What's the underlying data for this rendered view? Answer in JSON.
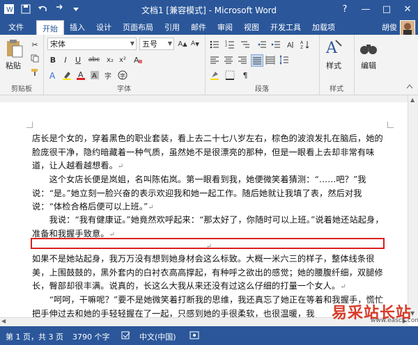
{
  "window": {
    "title": "文档1 [兼容模式] - Microsoft Word",
    "controls": [
      "?",
      "—",
      "□",
      "✕"
    ]
  },
  "tabs": {
    "file": "文件",
    "items": [
      "开始",
      "插入",
      "设计",
      "页面布局",
      "引用",
      "邮件",
      "审阅",
      "视图",
      "开发工具",
      "加载项"
    ],
    "active": "开始",
    "user": "胡俊"
  },
  "ribbon": {
    "clipboard": {
      "paste": "粘贴",
      "label": "剪贴板"
    },
    "font": {
      "name": "宋体",
      "size": "五号",
      "label": "字体",
      "buttons": [
        "B",
        "I",
        "U",
        "abc",
        "x₂",
        "x²"
      ]
    },
    "paragraph": {
      "label": "段落"
    },
    "styles": {
      "button": "样式",
      "label": "样式"
    },
    "editing": {
      "button": "编辑"
    }
  },
  "document": {
    "paragraphs": [
      "店长是个女的，穿着黑色的职业套装，看上去二十七八岁左右，棕色的波浪发扎在脑后，她的脸庞很干净，隐约暗藏着一种气质，虽然她不是很漂亮的那种，但是一眼看上去却非常有味道，让人越看越想看。",
      "　　这个女店长便是岚姐，名叫陈佑岚。第一眼看到我，她便微笑着猜测：“……吧？”我说：“是。”她立刻一脸兴奋的表示欢迎我和她一起工作。随后她就让我填了表，然后对我说：“体检合格后便可以上班。”",
      "　　我说：“我有健康证。”她竟然欢呼起来：“那太好了，你随时可以上班。”说着她还站起身，准备和我握手致意。",
      "",
      "如果不是她站起身，我万万没有想到她身材会这么标致。大概一米六三的样子，整体线条很美，上围鼓鼓的，黑外套内的白衬衣高高撑起，有种呼之欲出的感觉；她的腰腹纤细，双腿修长，臀部却很丰满。说真的，长这么大我从来还没有过这么仔细的打量一个女人。",
      "　　“呵呵，干嘛呢？”要不是她微笑着打断我的思维，我还真忘了她正在等着和我握手，慌忙把手伸过去和她的手轻轻握在了一起，只感到她的手很柔软，也很温暖，我"
    ]
  },
  "status": {
    "page": "第 1 页，共 3 页",
    "words": "3790 个字",
    "lang": "中文(中国)"
  },
  "watermark": {
    "text": "易采站长站",
    "url": "www.easck.com"
  },
  "colors": {
    "accent": "#2b579a",
    "highlight_box": "#d92020"
  }
}
